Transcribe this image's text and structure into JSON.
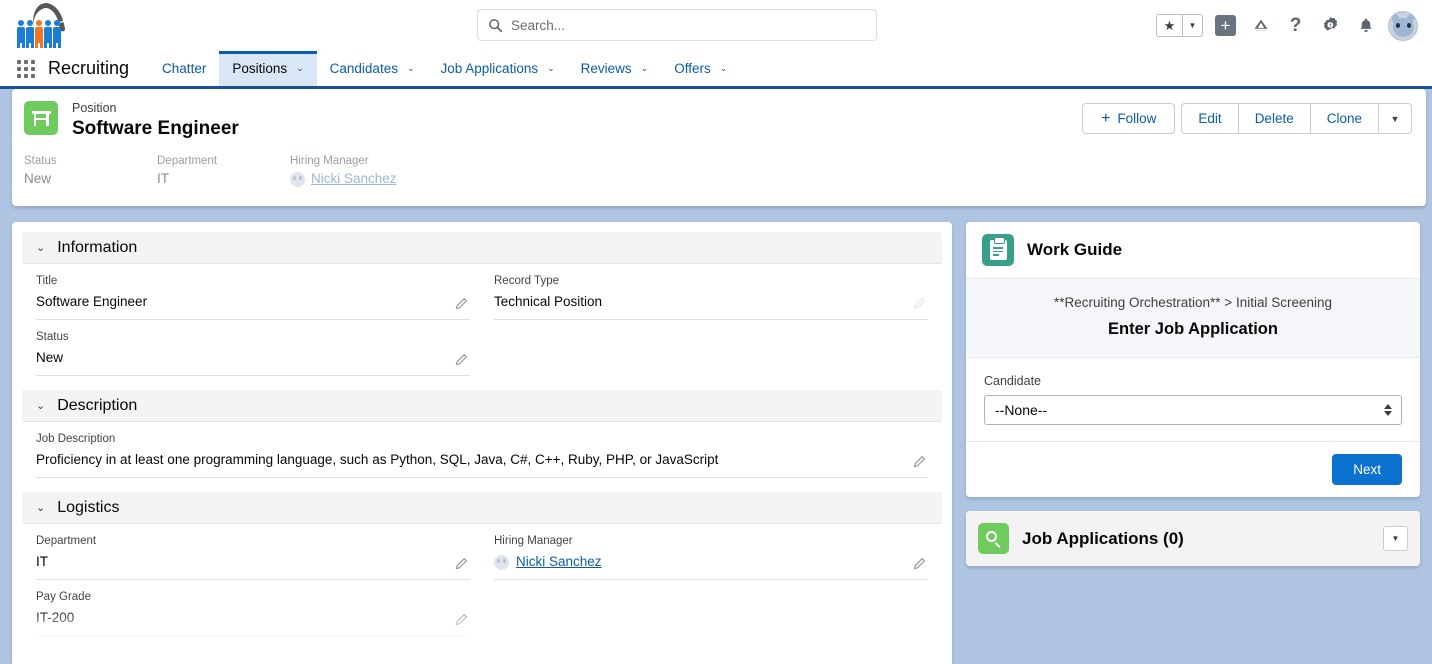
{
  "global_header": {
    "logo_name": "recruiting-logo",
    "search": {
      "placeholder": "Search...",
      "value": ""
    },
    "icons": [
      {
        "name": "favorites-star-icon",
        "glyph": "★"
      },
      {
        "name": "favorites-dropdown-icon",
        "glyph": "▼"
      },
      {
        "name": "global-actions-plus-icon",
        "glyph": "+"
      },
      {
        "name": "trailhead-icon",
        "glyph": ""
      },
      {
        "name": "help-icon",
        "glyph": "?"
      },
      {
        "name": "setup-gear-icon",
        "glyph": ""
      },
      {
        "name": "notifications-bell-icon",
        "glyph": ""
      },
      {
        "name": "user-avatar",
        "glyph": ""
      }
    ]
  },
  "app_nav": {
    "launcher_label": "app-launcher",
    "app_name": "Recruiting",
    "tabs": [
      {
        "label": "Chatter",
        "has_caret": false,
        "active": false
      },
      {
        "label": "Positions",
        "has_caret": true,
        "active": true
      },
      {
        "label": "Candidates",
        "has_caret": true,
        "active": false
      },
      {
        "label": "Job Applications",
        "has_caret": true,
        "active": false
      },
      {
        "label": "Reviews",
        "has_caret": true,
        "active": false
      },
      {
        "label": "Offers",
        "has_caret": true,
        "active": false
      }
    ],
    "caret_glyph": "⌄"
  },
  "record_header": {
    "object_type": "Position",
    "record_name": "Software Engineer",
    "highlights": [
      {
        "label": "Status",
        "value": "New",
        "is_link": false
      },
      {
        "label": "Department",
        "value": "IT",
        "is_link": false
      },
      {
        "label": "Hiring Manager",
        "value": "Nicki Sanchez",
        "is_link": true
      }
    ],
    "actions": {
      "follow": "Follow",
      "follow_icon": "+",
      "edit": "Edit",
      "delete": "Delete",
      "clone": "Clone",
      "more_glyph": "▼"
    }
  },
  "details": {
    "sections": [
      {
        "title": "Information",
        "chevron": "⌄",
        "layout": "two-column",
        "left_fields": [
          {
            "label": "Title",
            "value": "Software Engineer",
            "editable": true
          },
          {
            "label": "Status",
            "value": "New",
            "editable": true
          }
        ],
        "right_fields": [
          {
            "label": "Record Type",
            "value": "Technical Position",
            "editable": false
          }
        ]
      },
      {
        "title": "Description",
        "chevron": "⌄",
        "layout": "full",
        "fields": [
          {
            "label": "Job Description",
            "value": "Proficiency in at least one programming language, such as Python, SQL, Java, C#, C++, Ruby, PHP, or JavaScript",
            "editable": true
          }
        ]
      },
      {
        "title": "Logistics",
        "chevron": "⌄",
        "layout": "two-column",
        "left_fields": [
          {
            "label": "Department",
            "value": "IT",
            "editable": true
          },
          {
            "label": "Pay Grade",
            "value": "IT-200",
            "editable": true
          }
        ],
        "right_fields": [
          {
            "label": "Hiring Manager",
            "value": "Nicki Sanchez",
            "editable": true,
            "is_link": true
          }
        ]
      }
    ]
  },
  "work_guide": {
    "title": "Work Guide",
    "icon_name": "clipboard-icon",
    "orchestration_path": "**Recruiting Orchestration** > Initial Screening",
    "step_title": "Enter Job Application",
    "candidate_label": "Candidate",
    "candidate_value": "--None--",
    "next_label": "Next",
    "next_color": "#0b72d0"
  },
  "job_applications": {
    "title": "Job Applications (0)",
    "icon_name": "job-application-icon",
    "caret_glyph": "▼"
  },
  "colors": {
    "page_background": "#aec4e0",
    "brand_blue": "#0b5cab",
    "nav_underline": "#1b5297",
    "active_tab_bg": "#d8e6f6",
    "record_icon_green": "#6fcb5d",
    "work_guide_teal": "#3a9e8c"
  }
}
